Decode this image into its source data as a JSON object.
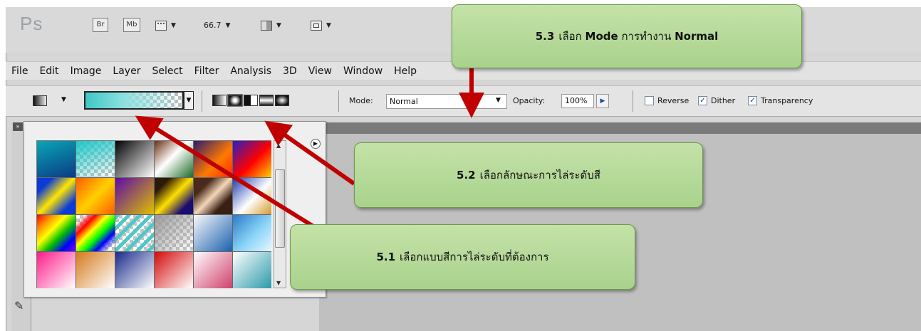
{
  "appbar": {
    "logo": "Ps",
    "bridge_label": "Br",
    "minibridge_label": "Mb",
    "zoom_value": "66.7"
  },
  "menubar": {
    "items": [
      "File",
      "Edit",
      "Image",
      "Layer",
      "Select",
      "Filter",
      "Analysis",
      "3D",
      "View",
      "Window",
      "Help"
    ]
  },
  "options": {
    "mode_label": "Mode:",
    "mode_value": "Normal",
    "opacity_label": "Opacity:",
    "opacity_value": "100%",
    "reverse_label": "Reverse",
    "reverse_checked": false,
    "dither_label": "Dither",
    "dither_checked": true,
    "transparency_label": "Transparency",
    "transparency_checked": true
  },
  "gradients": [
    "linear-gradient(160deg,#0aa6b5,#0b3a85)",
    "linear-gradient(160deg,#1ec7c7,transparent)",
    "linear-gradient(135deg,#000,#fff)",
    "linear-gradient(135deg,#6a2d10,#ffffff 45%,#1a6a24)",
    "linear-gradient(135deg,#2c1a6e,#ff7a00 60%,#ff2a00)",
    "linear-gradient(135deg,#2b1cc0,#ff0000 55%,#ffd400)",
    "linear-gradient(135deg,#0a3ad8 20%,#ffe600 50%,#0a3ad8 80%)",
    "linear-gradient(135deg,#ff5a00,#ffd000 50%,#ff5a00)",
    "linear-gradient(135deg,#5b0aa8,#e0c000)",
    "linear-gradient(135deg,#2b1a0a 20%,#ffe000 50%,#1a0c70 80%)",
    "linear-gradient(135deg,#4a2a1a 25%,#f4d6b8 50%,#3a2014 75%)",
    "linear-gradient(135deg,#1a3ab0,#ffffff 55%,#d49a2a)",
    "linear-gradient(135deg,#ff0000,#ff8a00,#ffff00,#00c000,#0000ff,#8000ff)",
    "linear-gradient(135deg,transparent 10%,#ff0000,#ffff00,#00ff00,#0000ff,transparent 90%)",
    "repeating-linear-gradient(135deg,#4cc8c8 0 5px,transparent 5px 11px)",
    "linear-gradient(135deg,#9a9a9a,transparent)",
    "linear-gradient(135deg,#fafafa,#1a60b0)",
    "linear-gradient(135deg,#2a7ac8,#8ad4f8 55%,#e8f6ff)",
    "linear-gradient(135deg,#ff1a8a,#ffffff)",
    "linear-gradient(135deg,#d47a1a,#ffffff)",
    "linear-gradient(135deg,#1a2a8a,#ffffff)",
    "linear-gradient(135deg,#d40a0a,#ffffff)",
    "linear-gradient(135deg,#ffffff,#d0406a)",
    "linear-gradient(135deg,#ffffff,#2a9aaa)"
  ],
  "checker_cells": [
    1,
    13,
    14,
    15
  ],
  "callouts": {
    "c53_num": "5.3",
    "c53_text1": "เลือก",
    "c53_mode": "Mode",
    "c53_text2": "การทำงาน",
    "c53_normal": "Normal",
    "c52_num": "5.2",
    "c52_text": "เลือกลักษณะการไล่ระดับสี",
    "c51_num": "5.1",
    "c51_text": "เลือกแบบสีการไล่ระดับที่ต้องการ"
  },
  "colors": {
    "callout_fill": "#a9d28c",
    "arrow": "#c00000"
  }
}
